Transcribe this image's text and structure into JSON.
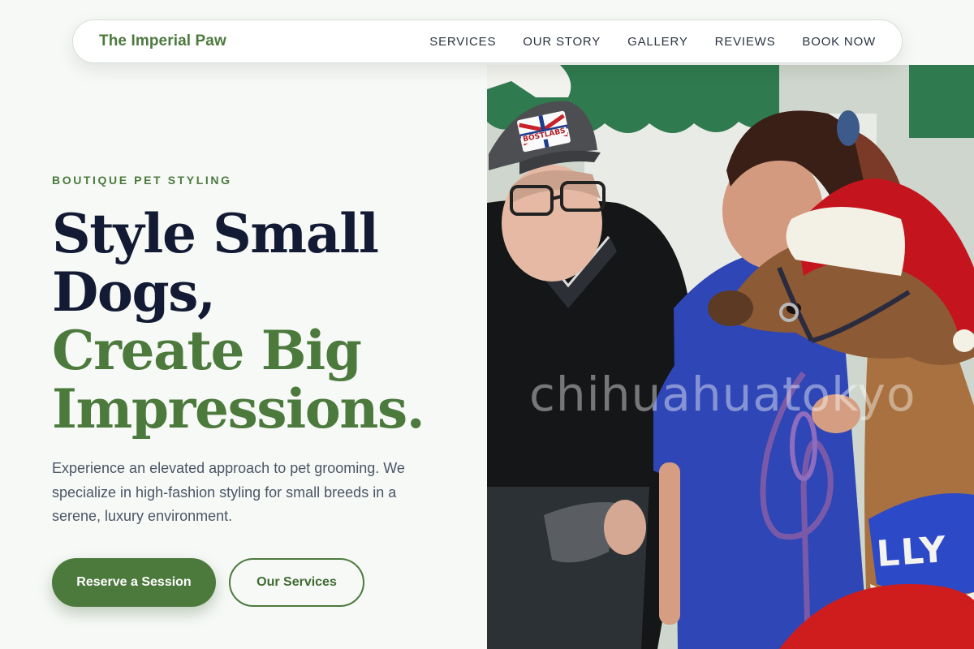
{
  "nav": {
    "brand": "The Imperial Paw",
    "links": [
      "SERVICES",
      "OUR STORY",
      "GALLERY",
      "REVIEWS",
      "BOOK NOW"
    ]
  },
  "hero": {
    "eyebrow": "BOUTIQUE PET STYLING",
    "headline_dark_1": "Style Small",
    "headline_dark_2": "Dogs,",
    "headline_green_1": "Create Big",
    "headline_green_2": "Impressions.",
    "lead": "Experience an elevated approach to pet grooming. We specialize in high-fashion styling for small breeds in a serene, luxury environment.",
    "primary_cta": "Reserve a Session",
    "secondary_cta": "Our Services"
  },
  "photo": {
    "watermark": "chihuahuatokyo",
    "hat_badge": "BOSTLABS",
    "sweater_text": "LLY"
  },
  "colors": {
    "accent": "#4c7a3d",
    "headline_dark": "#131a33",
    "background": "#f7f9f7"
  }
}
